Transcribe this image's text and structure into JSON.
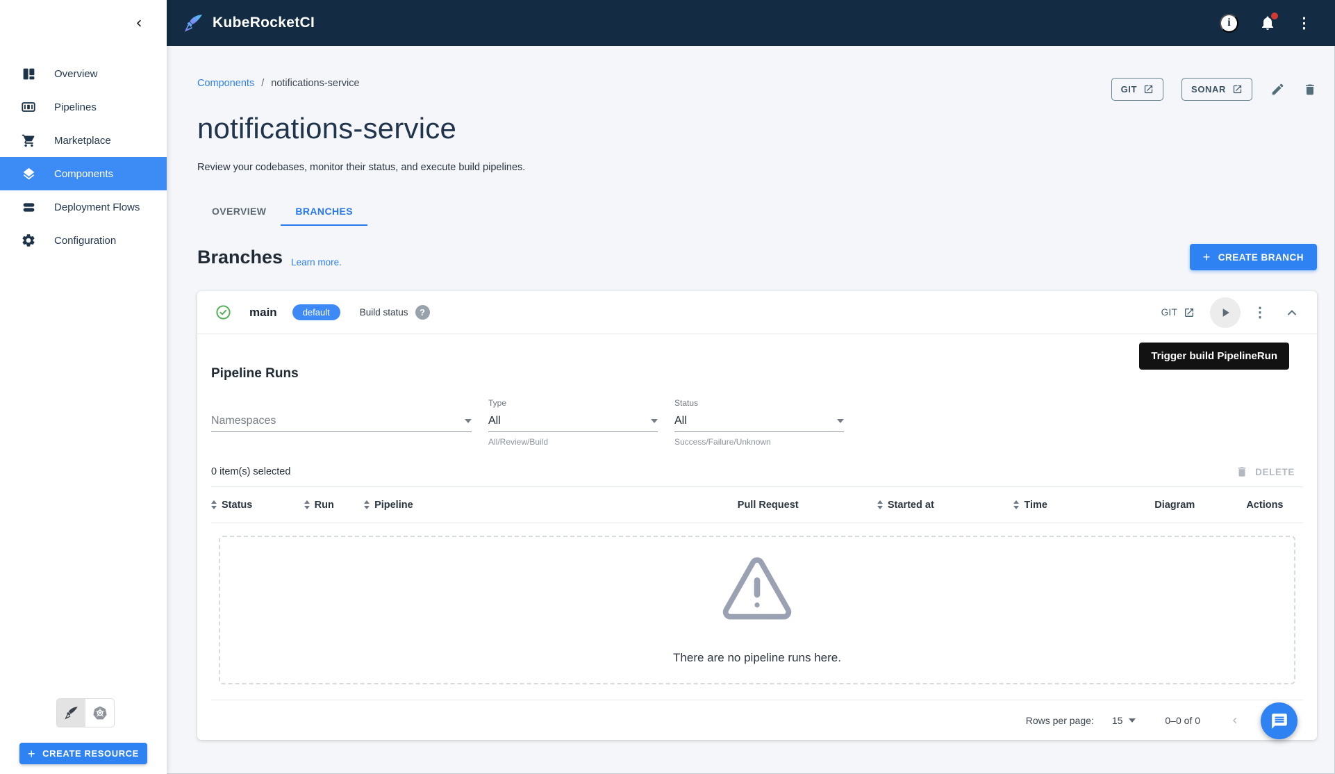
{
  "colors": {
    "primary": "#2f82f1",
    "header_bg": "#132c43",
    "active_nav": "#3d8bf5",
    "chip": "#3d8af7",
    "link": "#2d7ff0"
  },
  "header": {
    "title": "KubeRocketCI"
  },
  "sidebar": {
    "items": [
      {
        "label": "Overview"
      },
      {
        "label": "Pipelines"
      },
      {
        "label": "Marketplace"
      },
      {
        "label": "Components",
        "active": true
      },
      {
        "label": "Deployment Flows"
      },
      {
        "label": "Configuration"
      }
    ],
    "create_resource": "CREATE RESOURCE"
  },
  "breadcrumb": {
    "parent": "Components",
    "separator": "/",
    "current": "notifications-service"
  },
  "page": {
    "title": "notifications-service",
    "subtitle": "Review your codebases, monitor their status, and execute build pipelines."
  },
  "page_actions": {
    "git": "GIT",
    "sonar": "SONAR"
  },
  "tabs": [
    {
      "label": "OVERVIEW"
    },
    {
      "label": "BRANCHES"
    }
  ],
  "branches_section": {
    "heading": "Branches",
    "learn_more": "Learn more.",
    "create_branch": "CREATE BRANCH"
  },
  "branch": {
    "name": "main",
    "chip": "default",
    "build_status": "Build status",
    "help": "?",
    "git": "GIT",
    "tooltip": "Trigger build PipelineRun"
  },
  "pipeline_runs": {
    "heading": "Pipeline Runs",
    "filters": {
      "namespaces": {
        "placeholder": "Namespaces"
      },
      "type": {
        "label": "Type",
        "value": "All",
        "helper": "All/Review/Build"
      },
      "status": {
        "label": "Status",
        "value": "All",
        "helper": "Success/Failure/Unknown"
      }
    },
    "selection": "0 item(s) selected",
    "delete": "DELETE",
    "table": {
      "columns": [
        {
          "label": "Status",
          "sortable": true
        },
        {
          "label": "Run",
          "sortable": true
        },
        {
          "label": "Pipeline",
          "sortable": true
        },
        {
          "label": "Pull Request",
          "sortable": false
        },
        {
          "label": "Started at",
          "sortable": true
        },
        {
          "label": "Time",
          "sortable": true
        },
        {
          "label": "Diagram",
          "sortable": false
        },
        {
          "label": "Actions",
          "sortable": false
        }
      ]
    },
    "empty": "There are no pipeline runs here.",
    "pagination": {
      "rows_label": "Rows per page:",
      "rows_value": "15",
      "range": "0–0 of 0"
    }
  }
}
